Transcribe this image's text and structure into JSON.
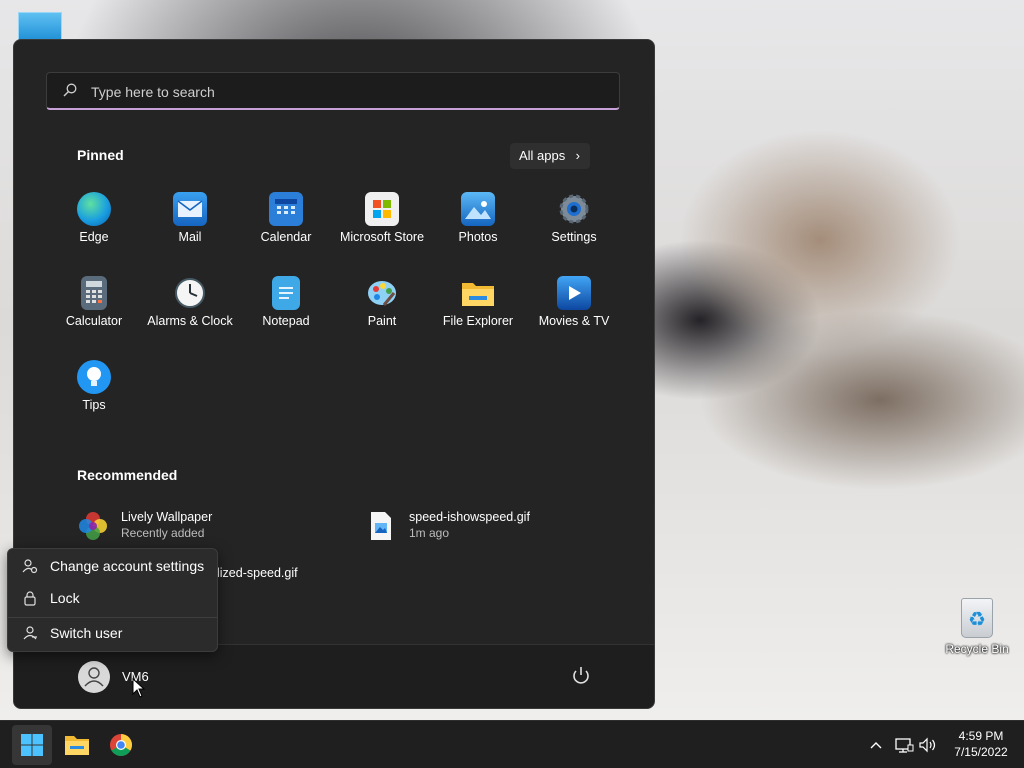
{
  "desktop": {
    "recycle_bin_label": "Recycle Bin"
  },
  "start_menu": {
    "search": {
      "placeholder": "Type here to search"
    },
    "pinned_title": "Pinned",
    "all_apps_label": "All apps",
    "pinned_apps": [
      {
        "label": "Edge",
        "icon": "edge-icon",
        "color": "#1a9fe0"
      },
      {
        "label": "Mail",
        "icon": "mail-icon",
        "color": "#1e88e5"
      },
      {
        "label": "Calendar",
        "icon": "calendar-icon",
        "color": "#2b7fd8"
      },
      {
        "label": "Microsoft Store",
        "icon": "microsoft-store-icon",
        "color": "#f0f0f0"
      },
      {
        "label": "Photos",
        "icon": "photos-icon",
        "color": "#1f8de0"
      },
      {
        "label": "Settings",
        "icon": "settings-gear-icon",
        "color": "#6e7d8c"
      },
      {
        "label": "Calculator",
        "icon": "calculator-icon",
        "color": "#5a6b7b"
      },
      {
        "label": "Alarms & Clock",
        "icon": "alarm-clock-icon",
        "color": "#e8e8e8"
      },
      {
        "label": "Notepad",
        "icon": "notepad-icon",
        "color": "#3ea9e6"
      },
      {
        "label": "Paint",
        "icon": "paint-palette-icon",
        "color": "#2a9be3"
      },
      {
        "label": "File Explorer",
        "icon": "folder-icon",
        "color": "#f5c542"
      },
      {
        "label": "Movies & TV",
        "icon": "movies-tv-icon",
        "color": "#1976d2"
      },
      {
        "label": "Tips",
        "icon": "tips-lightbulb-icon",
        "color": "#2196f3"
      }
    ],
    "recommended_title": "Recommended",
    "recommended": [
      {
        "name": "Lively Wallpaper",
        "sub": "Recently added",
        "icon": "lively-wallpaper-icon"
      },
      {
        "name": "speed-ishowspeed.gif",
        "sub": "1m ago",
        "icon": "image-file-icon"
      },
      {
        "name": "lized-speed.gif",
        "sub": "",
        "icon": "image-file-icon"
      }
    ],
    "user": {
      "name": "VM6"
    }
  },
  "account_flyout": {
    "items": [
      {
        "label": "Change account settings",
        "icon": "account-settings-icon"
      },
      {
        "label": "Lock",
        "icon": "lock-icon"
      },
      {
        "label": "Switch user",
        "icon": "switch-user-icon"
      }
    ]
  },
  "taskbar": {
    "time": "4:59 PM",
    "date": "7/15/2022"
  },
  "colors": {
    "start_bg": "#242424",
    "search_accent": "#c7a0d8",
    "taskbar_bg": "#1f1f1f",
    "flyout_bg": "#2b2b2b"
  }
}
